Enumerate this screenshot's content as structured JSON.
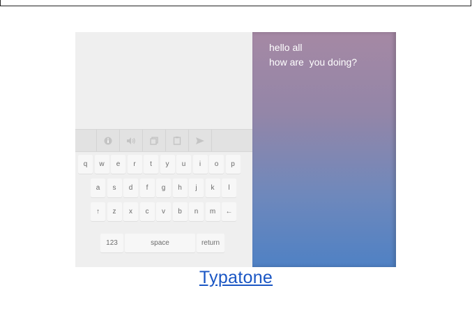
{
  "message": {
    "line1": "hello all",
    "line2": "how are  you doing?"
  },
  "toolbar": [
    "info-icon",
    "speaker-icon",
    "copy-icon",
    "clipboard-icon",
    "send-icon"
  ],
  "keyboard": {
    "row1": [
      "q",
      "w",
      "e",
      "r",
      "t",
      "y",
      "u",
      "i",
      "o",
      "p"
    ],
    "row2": [
      "a",
      "s",
      "d",
      "f",
      "g",
      "h",
      "j",
      "k",
      "l"
    ],
    "row3": [
      "↑",
      "z",
      "x",
      "c",
      "v",
      "b",
      "n",
      "m",
      "←"
    ],
    "row4": [
      "123",
      "space",
      "return"
    ]
  },
  "caption": "Typatone",
  "colors": {
    "gradient_top": "#a588a4",
    "gradient_bottom": "#4f81c4",
    "keyboard_bg": "#efefef",
    "link": "#1a56c4"
  }
}
